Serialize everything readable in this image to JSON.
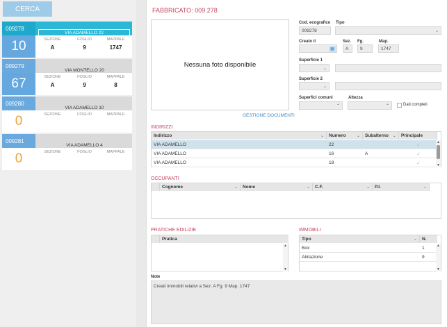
{
  "sidebar": {
    "search_label": "CERCA",
    "cards": [
      {
        "code": "009278",
        "address": "VIA ADAMELLO 22",
        "count": "10",
        "sezione_label": "SEZIONE",
        "foglio_label": "FOGLIO",
        "mappale_label": "MAPPALE",
        "sezione": "A",
        "foglio": "9",
        "mappale": "1747"
      },
      {
        "code": "009279",
        "address": "VIA MONTELLO 20",
        "count": "67",
        "sezione_label": "SEZIONE",
        "foglio_label": "FOGLIO",
        "mappale_label": "MAPPALE",
        "sezione": "A",
        "foglio": "9",
        "mappale": "8"
      },
      {
        "code": "009280",
        "address": "VIA ADAMELLO 10",
        "count": "0",
        "sezione_label": "SEZIONE",
        "foglio_label": "FOGLIO",
        "mappale_label": "MAPPALE",
        "sezione": "",
        "foglio": "",
        "mappale": ""
      },
      {
        "code": "009281",
        "address": "VIA ADAMELLO 4",
        "count": "0",
        "sezione_label": "SEZIONE",
        "foglio_label": "FOGLIO",
        "mappale_label": "MAPPALE",
        "sezione": "",
        "foglio": "",
        "mappale": ""
      }
    ]
  },
  "detail": {
    "title": "FABBRICATO: 009 278",
    "photo_placeholder": "Nessuna foto disponibile",
    "gestione_label": "GESTIONE DOCUMENTI",
    "cod_ecografico_label": "Cod. ecografico",
    "cod_ecografico": "009278",
    "tipo_label": "Tipo",
    "tipo": "",
    "creato_il_label": "Creato il",
    "creato_il": "",
    "sez_label": "Sez.",
    "sez": "A",
    "fg_label": "Fg.",
    "fg": "9",
    "map_label": "Map.",
    "map": "1747",
    "superficie1_label": "Superficie 1",
    "superficie2_label": "Superficie 2",
    "superfici_comuni_label": "Superfici comuni",
    "altezza_label": "Altezza",
    "dati_completi_label": "Dati completi"
  },
  "indirizzi": {
    "title": "INDIRIZZI",
    "columns": [
      "Indirizzo",
      "Numero",
      "Subalterno",
      "Principale"
    ],
    "rows": [
      {
        "indirizzo": "VIA ADAMELLO",
        "numero": "22",
        "subalterno": "",
        "principale": "✓"
      },
      {
        "indirizzo": "VIA ADAMELLO",
        "numero": "16",
        "subalterno": "A",
        "principale": "✓"
      },
      {
        "indirizzo": "VIA ADAMELLO",
        "numero": "18",
        "subalterno": "",
        "principale": "✓"
      }
    ]
  },
  "occupanti": {
    "title": "OCCUPANTI",
    "columns": [
      "Cognome",
      "Nome",
      "C.F.",
      "P.I."
    ]
  },
  "pratiche": {
    "title": "PRATICHE EDILIZIE",
    "columns": [
      "Pratica"
    ]
  },
  "immobili": {
    "title": "IMMOBILI",
    "columns": [
      "Tipo",
      "N."
    ],
    "rows": [
      {
        "tipo": "Box",
        "n": "1"
      },
      {
        "tipo": "Abitazione",
        "n": "9"
      }
    ]
  },
  "note": {
    "label": "Note",
    "text": "Creati immobili relativi a Sez. A Fg. 9 Map. 1747"
  }
}
